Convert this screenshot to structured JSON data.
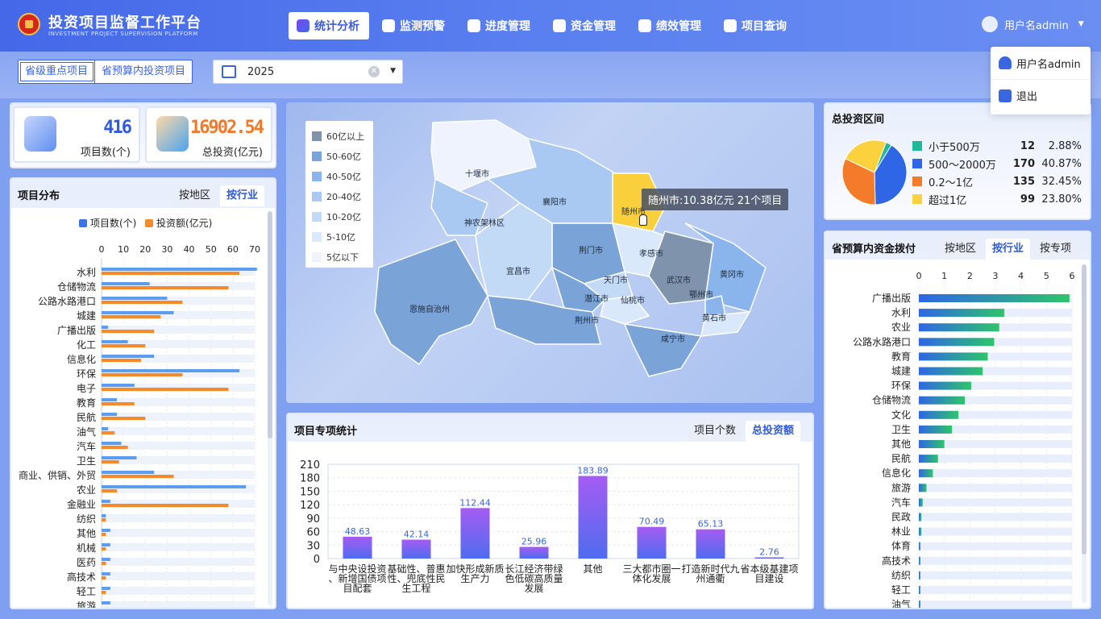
{
  "header": {
    "title": "投资项目监督工作平台",
    "subtitle": "INVESTMENT PROJECT SUPERVISION PLATFORM",
    "nav": [
      "统计分析",
      "监测预警",
      "进度管理",
      "资金管理",
      "绩效管理",
      "项目查询"
    ],
    "active_nav": 0,
    "user": "用户名admin"
  },
  "user_menu": {
    "items": [
      "用户名admin",
      "退出"
    ]
  },
  "filters": {
    "segments": [
      "省级重点项目",
      "省预算内投资项目"
    ],
    "active_segment": 0,
    "year": "2025"
  },
  "stats": {
    "project_count": {
      "value": "416",
      "label": "项目数(个)"
    },
    "total_investment": {
      "value": "16902.54",
      "label": "总投资(亿元)"
    }
  },
  "distribution": {
    "title": "项目分布",
    "tabs": [
      "按地区",
      "按行业"
    ],
    "active_tab": 1,
    "legend": [
      "项目数(个)",
      "投资额(亿元)"
    ],
    "axis_ticks": [
      "0",
      "10",
      "20",
      "30",
      "40",
      "50",
      "60",
      "70"
    ]
  },
  "map": {
    "legend": [
      "60亿以上",
      "50-60亿",
      "40-50亿",
      "20-40亿",
      "10-20亿",
      "5-10亿",
      "5亿以下"
    ],
    "legend_colors": [
      "#7f93ad",
      "#7aa3d8",
      "#8ab5ec",
      "#a9c9f2",
      "#c3daf7",
      "#dae8fb",
      "#eef3fd"
    ],
    "regions": [
      "十堰市",
      "襄阳市",
      "随州市",
      "神农架林区",
      "荆门市",
      "孝感市",
      "宜昌市",
      "天门市",
      "武汉市",
      "黄冈市",
      "恩施自治州",
      "潜江市",
      "仙桃市",
      "鄂州市",
      "荆州市",
      "黄石市",
      "咸宁市"
    ],
    "tooltip": "随州市:10.38亿元 21个项目"
  },
  "special": {
    "title": "项目专项统计",
    "tabs": [
      "项目个数",
      "总投资额"
    ],
    "active_tab": 1
  },
  "range": {
    "title": "总投资区间",
    "rows": [
      {
        "name": "小于500万",
        "count": "12",
        "pct": "2.88%",
        "color": "#1fb89a"
      },
      {
        "name": "500～2000万",
        "count": "170",
        "pct": "40.87%",
        "color": "#2f66e6"
      },
      {
        "name": "0.2～1亿",
        "count": "135",
        "pct": "32.45%",
        "color": "#f47b2a"
      },
      {
        "name": "超过1亿",
        "count": "99",
        "pct": "23.80%",
        "color": "#fbd23d"
      }
    ]
  },
  "budget": {
    "title": "省预算内资金拨付",
    "tabs": [
      "按地区",
      "按行业",
      "按专项"
    ],
    "active_tab": 1,
    "axis_ticks": [
      "0",
      "1",
      "2",
      "3",
      "4",
      "5",
      "6"
    ]
  },
  "chart_data": [
    {
      "type": "bar",
      "title": "项目分布",
      "orientation": "horizontal",
      "categories": [
        "水利",
        "仓储物流",
        "公路水路港口",
        "城建",
        "广播出版",
        "化工",
        "信息化",
        "环保",
        "电子",
        "教育",
        "民航",
        "油气",
        "汽车",
        "卫生",
        "商业、供销、外贸",
        "农业",
        "金融业",
        "纺织",
        "其他",
        "机械",
        "医药",
        "高技术",
        "轻工",
        "旅游"
      ],
      "series": [
        {
          "name": "项目数(个)",
          "values": [
            71,
            22,
            30,
            33,
            3,
            12,
            24,
            63,
            15,
            7,
            7,
            3,
            9,
            16,
            24,
            66,
            4,
            2,
            4,
            4,
            4,
            4,
            4,
            4
          ]
        },
        {
          "name": "投资额(亿元)",
          "values": [
            63,
            58,
            37,
            27,
            24,
            20,
            18,
            37,
            58,
            15,
            20,
            6,
            12,
            8,
            33,
            7,
            58,
            2,
            2,
            2,
            2,
            2,
            2,
            0
          ]
        }
      ],
      "xlim": [
        0,
        70
      ],
      "legend": "top"
    },
    {
      "type": "bar",
      "title": "项目专项统计",
      "categories": [
        "与中央设投资、新增国债项目配套",
        "基础性、普惠性、兜底性民生工程",
        "加快形成新质生产力",
        "长江经济带绿色低碳高质量发展",
        "其他",
        "三大都市圈一体化发展",
        "打造新时代九州通衢",
        "省本级基建项目建设"
      ],
      "values": [
        48.63,
        42.14,
        112.44,
        25.96,
        183.89,
        70.49,
        65.13,
        2.76
      ],
      "ylim": [
        0,
        210
      ],
      "yticks": [
        "0",
        "30",
        "60",
        "90",
        "120",
        "150",
        "180",
        "210"
      ]
    },
    {
      "type": "pie",
      "title": "总投资区间",
      "categories": [
        "小于500万",
        "500～2000万",
        "0.2～1亿",
        "超过1亿"
      ],
      "values": [
        12,
        170,
        135,
        99
      ]
    },
    {
      "type": "bar",
      "title": "省预算内资金拨付",
      "orientation": "horizontal",
      "categories": [
        "广播出版",
        "水利",
        "农业",
        "公路水路港口",
        "教育",
        "城建",
        "环保",
        "仓储物流",
        "文化",
        "卫生",
        "其他",
        "民航",
        "信息化",
        "旅游",
        "汽车",
        "民政",
        "林业",
        "体育",
        "高技术",
        "纺织",
        "轻工",
        "油气"
      ],
      "values": [
        5.9,
        3.35,
        3.15,
        2.95,
        2.7,
        2.5,
        2.05,
        1.8,
        1.55,
        1.3,
        1.0,
        0.75,
        0.55,
        0.3,
        0.15,
        0.1,
        0.1,
        0.05,
        0.05,
        0.03,
        0.03,
        0.02
      ],
      "xlim": [
        0,
        6
      ]
    }
  ]
}
